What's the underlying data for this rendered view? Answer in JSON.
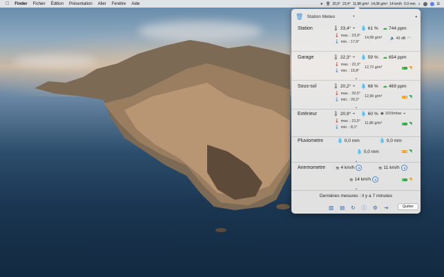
{
  "menubar": {
    "apple_icon": "apple-icon",
    "items": [
      "Finder",
      "Fichier",
      "Édition",
      "Présentation",
      "Aller",
      "Fenêtre",
      "Aide"
    ],
    "status": {
      "temp_out": "20,9°",
      "temp_in": "23,4°",
      "abs_humidity_1": "11,88 g/m³",
      "abs_humidity_2": "14,08 g/m³",
      "wind": "14 km/h",
      "rain": "0,0 mm"
    }
  },
  "panel": {
    "title": "Station Meteo",
    "sections": [
      {
        "name": "Station",
        "temp": "23,4°",
        "humidity": "61 %",
        "co2": "744 ppm",
        "max": "max. : 23,9°",
        "min": "min. : 17,9°",
        "abs_humidity": "14,08 g/m³",
        "noise": "43 dB"
      },
      {
        "name": "Garage",
        "temp": "22,3°",
        "humidity": "59 %",
        "co2": "654 ppm",
        "max": "max. : 22,3°",
        "min": "min. : 15,8°",
        "abs_humidity": "12,72 g/m³"
      },
      {
        "name": "Sous-sol",
        "temp": "20,2°",
        "humidity": "68 %",
        "co2": "469 ppm",
        "max": "max. : 20,5°",
        "min": "min. : 20,2°",
        "abs_humidity": "12,90 g/m³"
      },
      {
        "name": "Extérieur",
        "temp": "20,9°",
        "humidity": "60 %",
        "pressure": "1015mbar",
        "max": "max. : 21,5°",
        "min": "min. : 8,1°",
        "abs_humidity": "11,86 g/m³"
      }
    ],
    "rain": {
      "name": "Pluviometre",
      "value_1": "0,0 mm",
      "value_2": "0,0 mm",
      "value_3": "0,0 mm"
    },
    "wind": {
      "name": "Anemometre",
      "wind": "4 km/h",
      "gust": "11 km/h",
      "max": "14 km/h"
    },
    "last_update": "Dernières mesures : il y a 7 minutes",
    "quit_label": "Quitter"
  },
  "colors": {
    "accent_blue": "#3c8fd9",
    "green": "#3aa84a",
    "orange": "#f29a1e",
    "red": "#d83a2e"
  }
}
